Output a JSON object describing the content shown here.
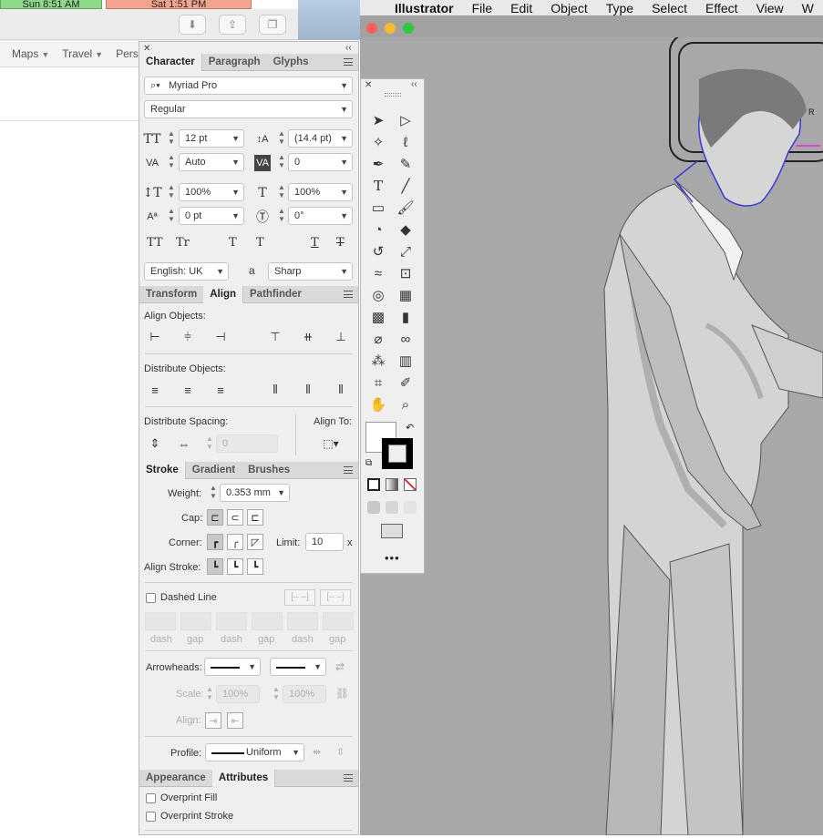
{
  "browser": {
    "tabs": [
      "Sun 8:51 AM",
      "Sat 1:51 PM"
    ],
    "bookmarks": [
      {
        "label": "Maps"
      },
      {
        "label": "Travel"
      },
      {
        "label": "Pers"
      }
    ]
  },
  "menubar": {
    "app": "Illustrator",
    "items": [
      "File",
      "Edit",
      "Object",
      "Type",
      "Select",
      "Effect",
      "View",
      "W"
    ]
  },
  "character": {
    "tabs": [
      "Character",
      "Paragraph",
      "Glyphs"
    ],
    "font_family": "Myriad Pro",
    "font_style": "Regular",
    "font_size": "12 pt",
    "leading": "(14.4 pt)",
    "kerning": "Auto",
    "tracking": "0",
    "vertical_scale": "100%",
    "horizontal_scale": "100%",
    "baseline_shift": "0 pt",
    "rotation": "0°",
    "language": "English: UK",
    "antialias_prefix": "a",
    "antialias": "Sharp",
    "type_buttons": [
      "TT",
      "Tr",
      "T",
      "T",
      "T",
      "T"
    ]
  },
  "align": {
    "tabs": [
      "Transform",
      "Align",
      "Pathfinder"
    ],
    "align_objects": "Align Objects:",
    "distribute_objects": "Distribute Objects:",
    "distribute_spacing": "Distribute Spacing:",
    "align_to": "Align To:",
    "spacing_value": "0"
  },
  "stroke": {
    "tabs": [
      "Stroke",
      "Gradient",
      "Brushes"
    ],
    "weight_label": "Weight:",
    "weight": "0.353 mm",
    "cap_label": "Cap:",
    "corner_label": "Corner:",
    "limit_label": "Limit:",
    "limit": "10",
    "limit_unit": "x",
    "align_stroke_label": "Align Stroke:",
    "dashed_line": "Dashed Line",
    "dash_labels": [
      "dash",
      "gap",
      "dash",
      "gap",
      "dash",
      "gap"
    ],
    "arrowheads_label": "Arrowheads:",
    "scale_label": "Scale:",
    "scale_start": "100%",
    "scale_end": "100%",
    "align_label": "Align:",
    "profile_label": "Profile:",
    "profile": "Uniform"
  },
  "attributes": {
    "tabs": [
      "Appearance",
      "Attributes"
    ],
    "overprint_fill": "Overprint Fill",
    "overprint_stroke": "Overprint Stroke"
  },
  "tools": {
    "more": "•••"
  },
  "colors": {
    "canvas": "#a8a8a8",
    "panel": "#efefef",
    "selection_blue": "#3a3ad8",
    "selection_magenta": "#e040e0",
    "traffic_red": "#fc5f57",
    "traffic_yellow": "#fdbc2e",
    "traffic_green": "#29c840"
  }
}
